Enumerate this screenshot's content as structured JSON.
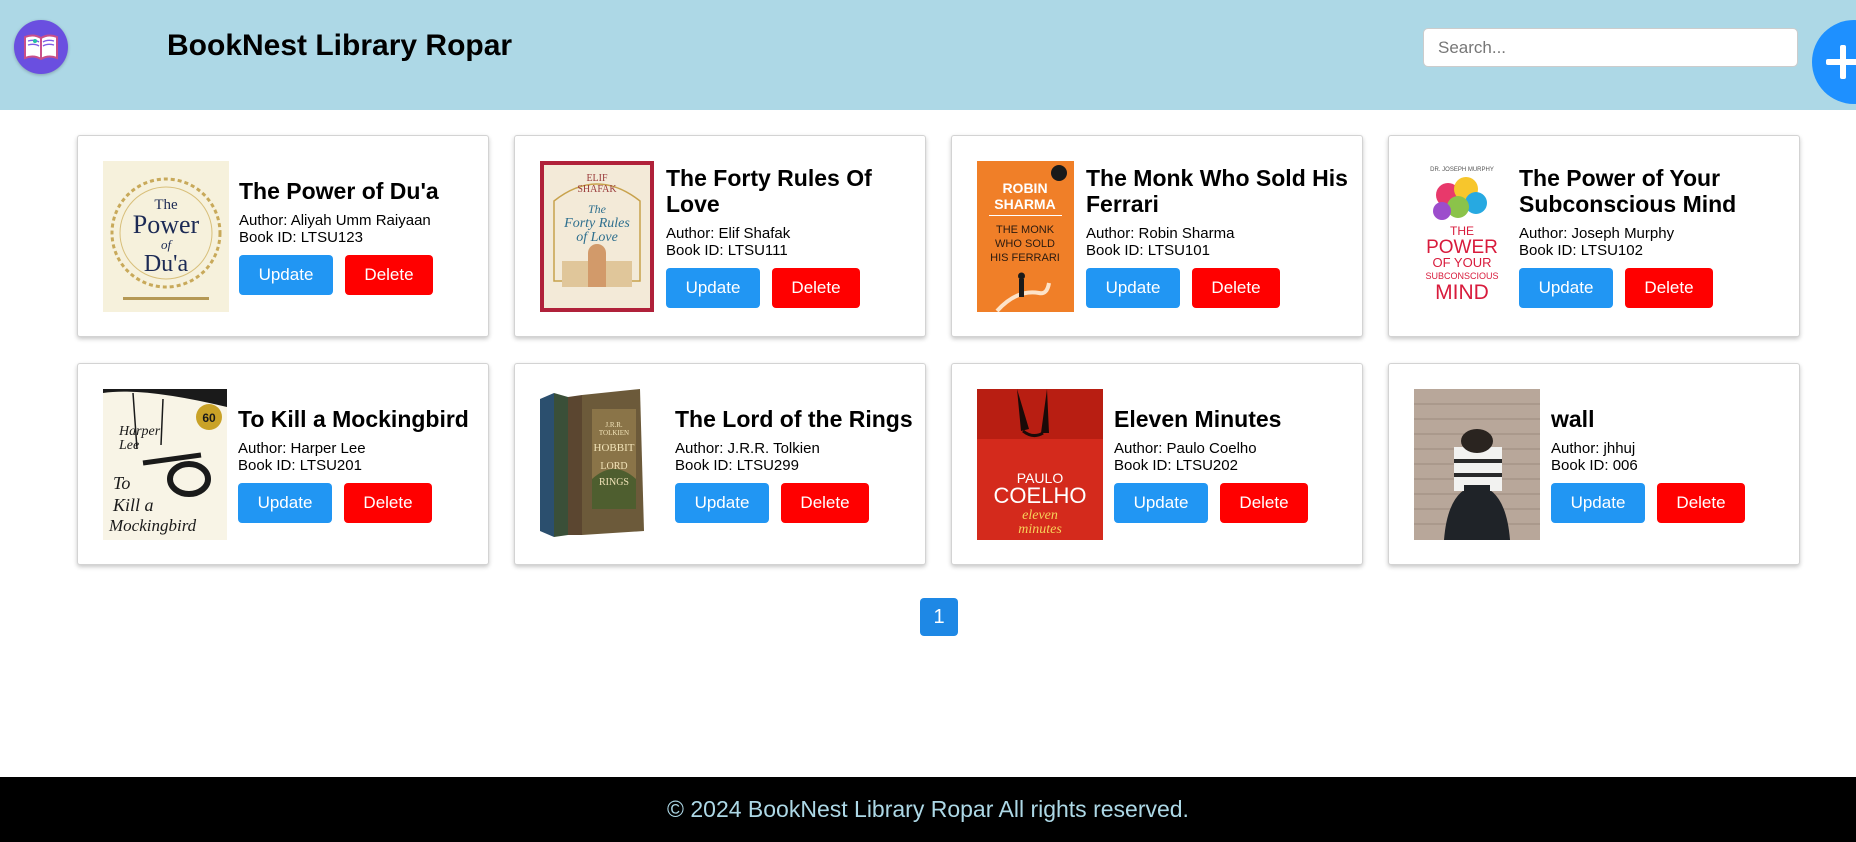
{
  "header": {
    "brand": "BookNest Library Ropar",
    "search_placeholder": "Search...",
    "add_label": "+"
  },
  "books": [
    {
      "title": "The Power of Du'a",
      "author": "Author: Aliyah Umm Raiyaan",
      "book_id": "Book ID: LTSU123",
      "cover_text": [
        "The",
        "Power",
        "of",
        "Du'a"
      ]
    },
    {
      "title": "The Forty Rules Of Love",
      "author": "Author: Elif Shafak",
      "book_id": "Book ID: LTSU111",
      "cover_text": [
        "ELIF",
        "SHAFAK",
        "The",
        "Forty Rules",
        "of Love"
      ]
    },
    {
      "title": "The Monk Who Sold His Ferrari",
      "author": "Author: Robin Sharma",
      "book_id": "Book ID: LTSU101",
      "cover_text": [
        "ROBIN",
        "SHARMA",
        "THE MONK",
        "WHO SOLD",
        "HIS FERRARI"
      ]
    },
    {
      "title": "The Power of Your Subconscious Mind",
      "author": "Author: Joseph Murphy",
      "book_id": "Book ID: LTSU102",
      "cover_text": [
        "DR. JOSEPH MURPHY",
        "THE",
        "POWER",
        "OF YOUR",
        "SUBCONSCIOUS",
        "MIND"
      ]
    },
    {
      "title": "To Kill a Mockingbird",
      "author": "Author: Harper Lee",
      "book_id": "Book ID: LTSU201",
      "cover_text": [
        "Harper",
        "Lee",
        "To",
        "Kill a",
        "Mockingbird",
        "60"
      ]
    },
    {
      "title": "The Lord of the Rings",
      "author": "Author: J.R.R. Tolkien",
      "book_id": "Book ID: LTSU299",
      "cover_text": [
        "J.R.R.",
        "TOLKIEN",
        "HOBBIT",
        "LORD",
        "RINGS"
      ]
    },
    {
      "title": "Eleven Minutes",
      "author": "Author: Paulo Coelho",
      "book_id": "Book ID: LTSU202",
      "cover_text": [
        "PAULO",
        "COELHO",
        "eleven",
        "minutes"
      ]
    },
    {
      "title": "wall",
      "author": "Author: jhhuj",
      "book_id": "Book ID: 006",
      "cover_text": []
    }
  ],
  "actions": {
    "update": "Update",
    "delete": "Delete"
  },
  "pagination": {
    "current": "1"
  },
  "footer": {
    "text": "© 2024 BookNest Library Ropar All rights reserved."
  },
  "colors": {
    "header_bg": "#add8e6",
    "update": "#2196f3",
    "delete": "#ff0000",
    "footer_bg": "#000000",
    "footer_text": "#add8e6"
  }
}
